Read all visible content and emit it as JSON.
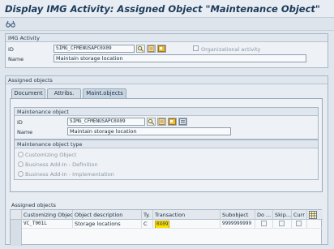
{
  "window": {
    "title": "Display IMG Activity: Assigned Object \"Maintenance Object\""
  },
  "toolbar": {
    "icon": "glasses-display-icon"
  },
  "img_activity": {
    "section_title": "IMG Activity",
    "id_label": "ID",
    "id_value": "SIMG_CFMENUSAPC0X09",
    "org_checkbox_label": "Organizational activity",
    "org_checked": false,
    "name_label": "Name",
    "name_value": "Maintain storage location"
  },
  "assigned_objects": {
    "section_title": "Assigned objects",
    "tabs": [
      {
        "label": "Document",
        "active": false
      },
      {
        "label": "Attribs.",
        "active": false
      },
      {
        "label": "Maint.objects",
        "active": true
      }
    ],
    "maintenance_object": {
      "title": "Maintenance object",
      "id_label": "ID",
      "id_value": "SIMG_CFMENUSAPC0X09",
      "name_label": "Name",
      "name_value": "Maintain storage location"
    },
    "object_type": {
      "title": "Maintenance object type",
      "options": [
        {
          "label": "Customizing Object",
          "selected": true
        },
        {
          "label": "Business Add-In - Definition",
          "selected": false
        },
        {
          "label": "Business Add-In - Implementation",
          "selected": false
        }
      ]
    },
    "table": {
      "title": "Assigned objects",
      "columns": [
        "Customizing Object",
        "Object description",
        "Ty.",
        "Transaction",
        "Subobject",
        "Do ...",
        "Skip...",
        "Curr"
      ],
      "rows": [
        {
          "customizing_object": "VC_T001L",
          "description": "Storage locations",
          "type": "C",
          "transaction": "0X09",
          "subobject": "9999999999",
          "do": false,
          "skip": false,
          "curr": false
        }
      ]
    }
  }
}
